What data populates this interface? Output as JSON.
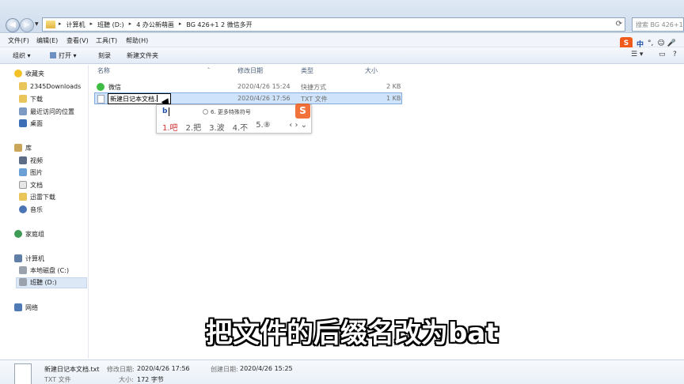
{
  "address": {
    "crumbs": [
      "计算机",
      "班聽 (D:)",
      "4 办公新萌画",
      "BG 426+1 2 微信多开"
    ],
    "search_placeholder": "搜索 BG 426+1..."
  },
  "menu": [
    "文件(F)",
    "编辑(E)",
    "查看(V)",
    "工具(T)",
    "帮助(H)"
  ],
  "toolbar": {
    "organize": "组织 ▾",
    "open": "打开 ▾",
    "burn": "刻录",
    "new_folder": "新建文件夹"
  },
  "sogou": {
    "logo": "S",
    "lang": "中",
    "punct": "°,",
    "icons": "☺ 🎤"
  },
  "sidebar": {
    "favorites": "收藏夹",
    "fav_items": [
      "2345Downloads",
      "下载",
      "最近访问的位置",
      "桌面"
    ],
    "library": "库",
    "lib_items": [
      "视频",
      "图片",
      "文档",
      "迅雷下载",
      "音乐"
    ],
    "homegroup": "家庭组",
    "computer": "计算机",
    "drives": [
      "本地磁盘 (C:)",
      "班聽 (D:)"
    ],
    "network": "网络"
  },
  "columns": {
    "name": "名称",
    "modified": "修改日期",
    "type": "类型",
    "size": "大小"
  },
  "files": [
    {
      "name": "微信",
      "modified": "2020/4/26 15:24",
      "type": "快捷方式",
      "size": "2 KB"
    },
    {
      "name": "新建日记本文档",
      "modified": "2020/4/26 17:56",
      "type": "TXT 文件",
      "size": "1 KB"
    }
  ],
  "rename_text": "新建日记本文档.",
  "ime": {
    "input": "b",
    "special": "6. 更多特殊符号",
    "candidates": [
      "1.吧",
      "2.把",
      "3.波",
      "4.不",
      "5.⑧"
    ],
    "arrows": "‹ › ⌄"
  },
  "subtitle": "把文件的后缀名改为bat",
  "details": {
    "filename": "新建日记本文档.txt",
    "modified_label": "修改日期:",
    "modified": "2020/4/26 17:56",
    "created_label": "创建日期:",
    "created": "2020/4/26 15:25",
    "type": "TXT 文件",
    "size_label": "大小:",
    "size": "172 字节"
  }
}
